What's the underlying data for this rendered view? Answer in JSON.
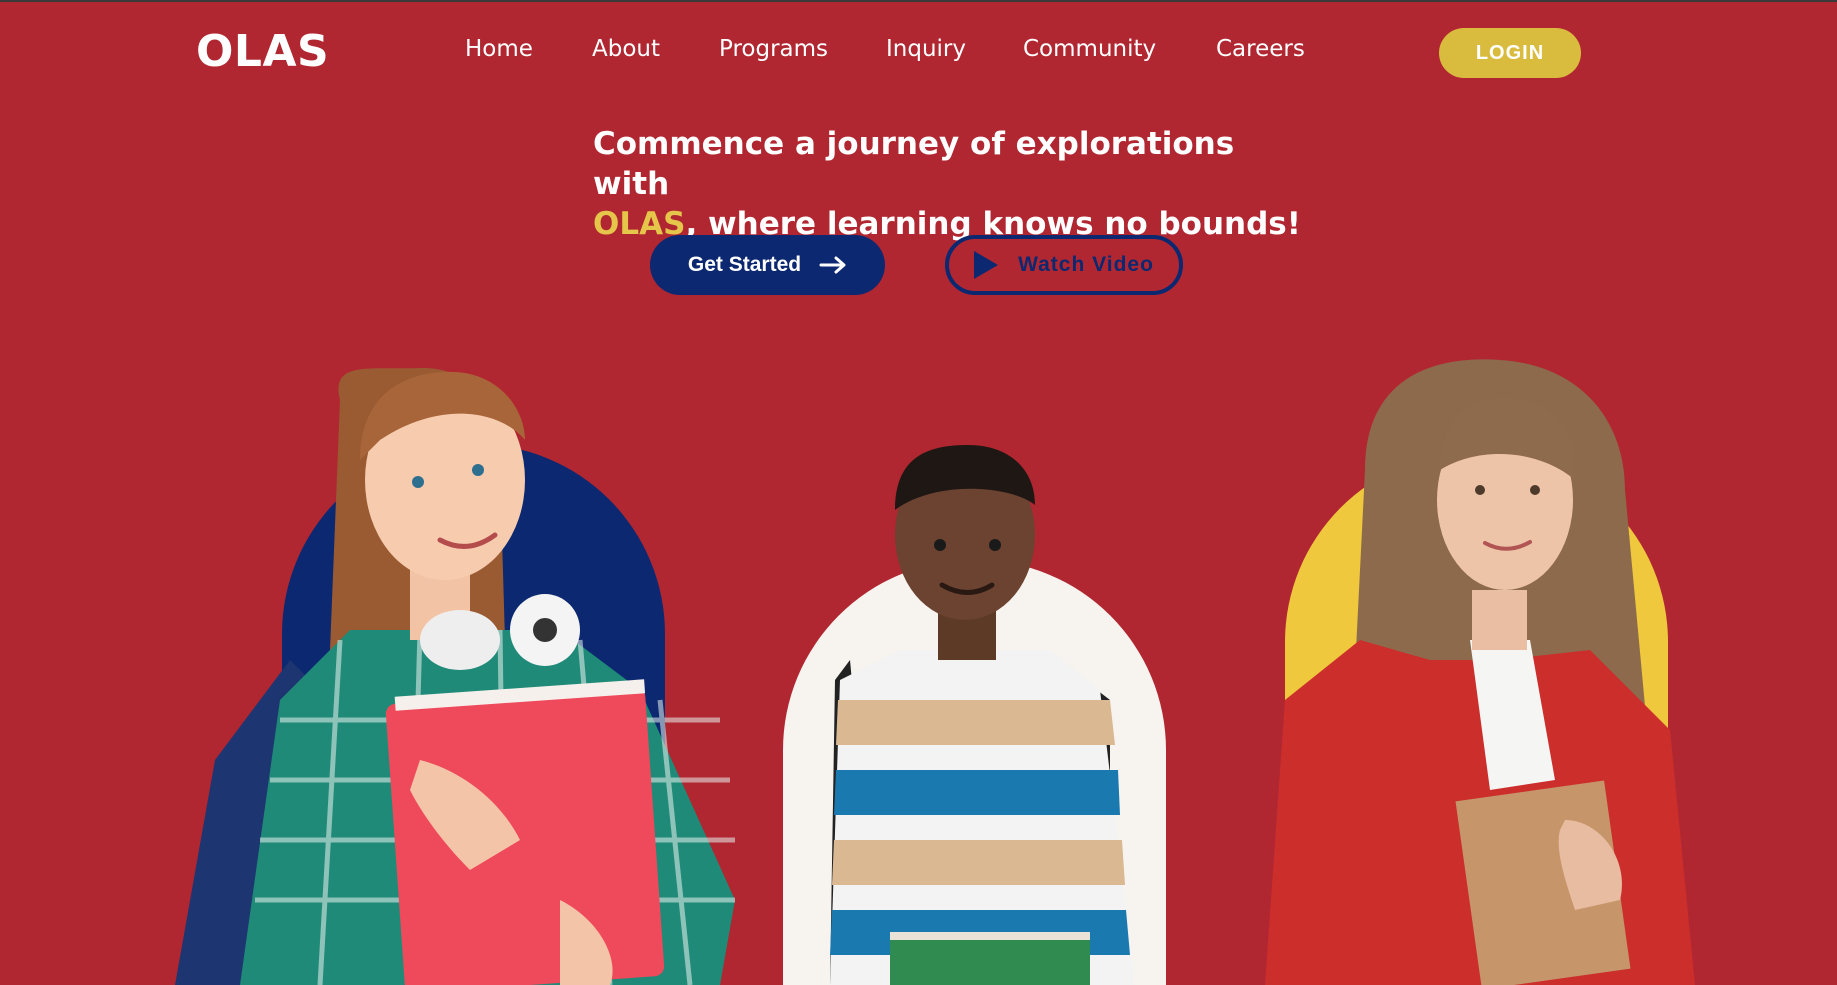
{
  "brand": {
    "logo": "OLAS"
  },
  "nav": {
    "items": [
      {
        "label": "Home"
      },
      {
        "label": "About"
      },
      {
        "label": "Programs"
      },
      {
        "label": "Inquiry"
      },
      {
        "label": "Community"
      },
      {
        "label": "Careers"
      }
    ],
    "login_label": "LOGIN"
  },
  "hero": {
    "headline_line1": "Commence a journey of explorations with",
    "headline_brand": "OLAS",
    "headline_line2_rest": ", where learning knows no bounds!",
    "cta_primary": "Get Started",
    "cta_secondary": "Watch Video"
  },
  "colors": {
    "background": "#b12731",
    "navy": "#0b2870",
    "gold": "#d9bc3e",
    "yellow_arch": "#f0c83d",
    "cream_arch": "#f7f3ef"
  },
  "icons": {
    "get_started": "arrow-right-icon",
    "watch_video": "play-icon"
  }
}
